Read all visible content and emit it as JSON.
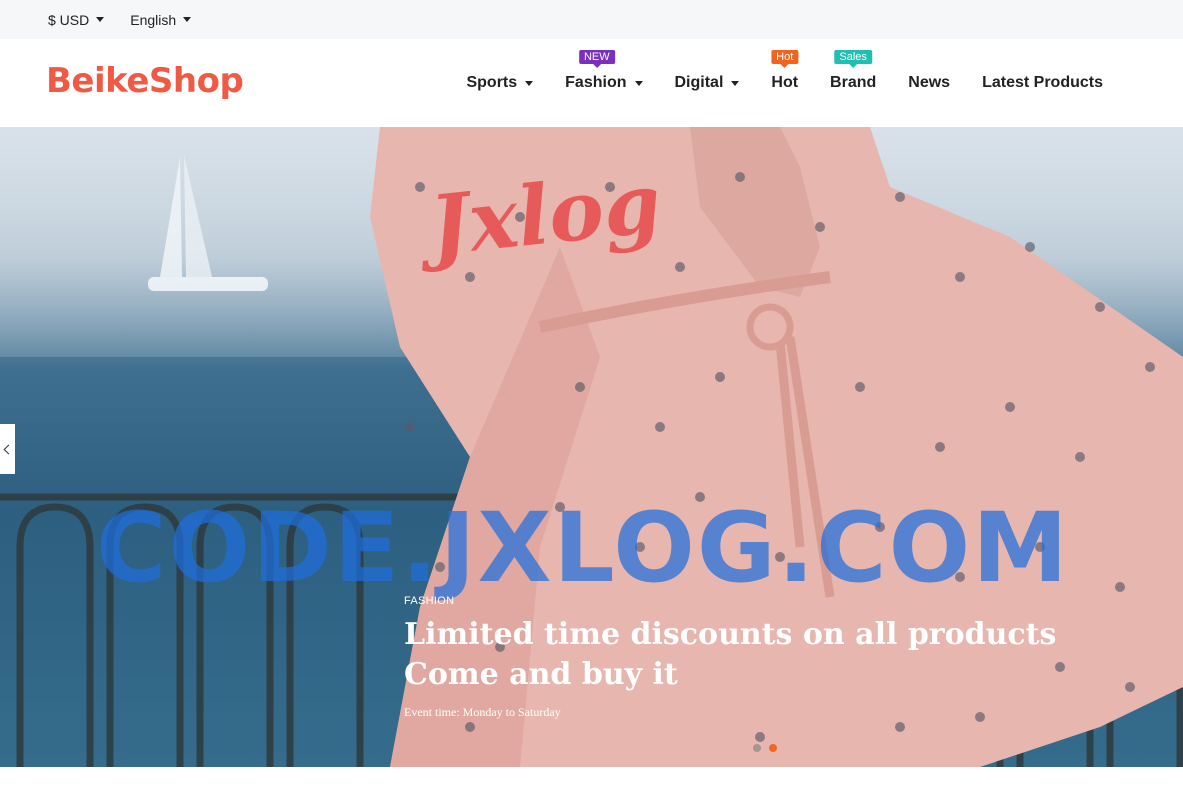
{
  "topbar": {
    "currency": "$ USD",
    "language": "English"
  },
  "header": {
    "logo": "BeikeShop"
  },
  "nav": [
    {
      "label": "Sports",
      "dropdown": true,
      "badge": null
    },
    {
      "label": "Fashion",
      "dropdown": true,
      "badge": {
        "text": "NEW",
        "color": "#7b2fbf"
      }
    },
    {
      "label": "Digital",
      "dropdown": true,
      "badge": null
    },
    {
      "label": "Hot",
      "dropdown": false,
      "badge": {
        "text": "Hot",
        "color": "#f0641e"
      }
    },
    {
      "label": "Brand",
      "dropdown": false,
      "badge": {
        "text": "Sales",
        "color": "#1fbfb3"
      }
    },
    {
      "label": "News",
      "dropdown": false,
      "badge": null
    },
    {
      "label": "Latest Products",
      "dropdown": false,
      "badge": null
    }
  ],
  "hero": {
    "tag": "FASHION",
    "title_line1": "Limited time discounts on all products",
    "title_line2": "Come and buy it",
    "subtitle": "Event time: Monday to Saturday",
    "watermark": "CODE.JXLOG.COM",
    "watermark_logo": "Jxlog",
    "slides": 2,
    "active_slide": 2,
    "accent": "#f26522"
  }
}
